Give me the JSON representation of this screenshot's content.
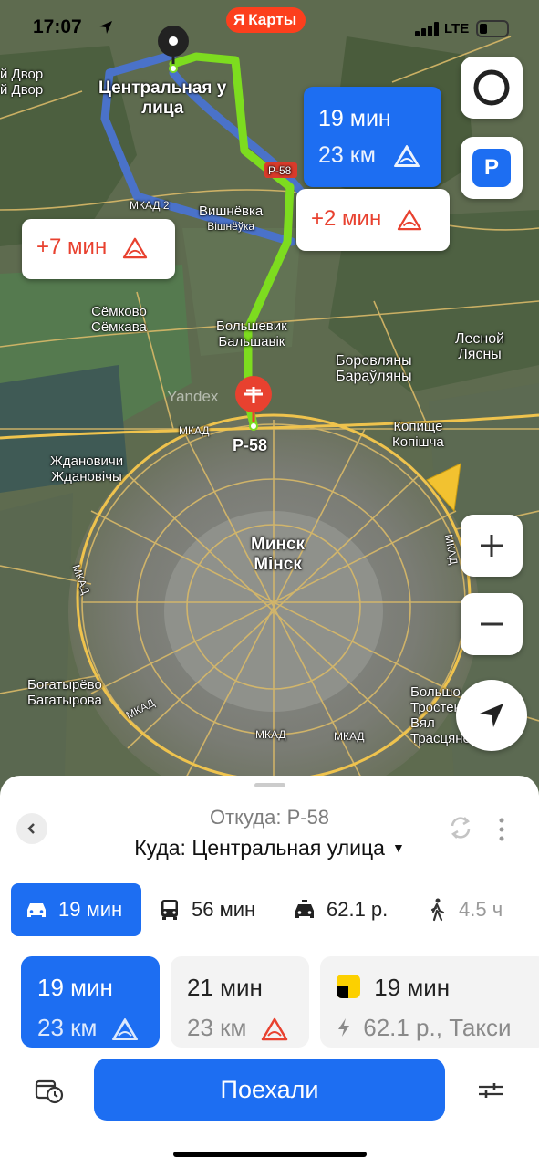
{
  "status_bar": {
    "time": "17:07",
    "network": "LTE"
  },
  "app_badge": {
    "logo": "Я",
    "label": "Карты"
  },
  "map": {
    "watermark": "Yandex",
    "labels": {
      "dvor1": "й Двор",
      "dvor2": "й Двор",
      "central1": "Центральная у",
      "central2": "лица",
      "vishnevka1": "Вишнёвка",
      "vishnevka2": "Вішнёўка",
      "mkad2": "МКАД 2",
      "p58_top": "Р-58",
      "semkovo1": "Сёмково",
      "semkovo2": "Сёмкава",
      "bolshevik1": "Большевик",
      "bolshevik2": "Бальшавік",
      "lesnoy1": "Лесной",
      "lesnoy2": "Лясны",
      "borovlyany1": "Боровляны",
      "borovlyany2": "Бараўляны",
      "mkad_center": "МКАД",
      "p58_bottom": "Р-58",
      "kopishche1": "Копище",
      "kopishche2": "Копішча",
      "zhdanovichi1": "Ждановичи",
      "zhdanovichi2": "Ждановічы",
      "minsk1": "Минск",
      "minsk2": "Мінск",
      "mkad_left": "МКАД",
      "mkad_right": "МКАД",
      "bogatyrevo1": "Богатырёво",
      "bogatyrevo2": "Багатырова",
      "mkad_bl": "МКАД",
      "mkad_b1": "МКАД",
      "mkad_b2": "МКАД",
      "bolshoe1": "Большо",
      "trostenets1": "Тростенец",
      "trostenets2": "Вял",
      "trostenets3": "Трасцянец"
    },
    "callouts": {
      "main_time": "19 мин",
      "main_dist": "23 км",
      "alt1": "+7 мин",
      "alt2": "+2 мин"
    },
    "parking_label": "P"
  },
  "sheet": {
    "from": "Откуда: Р-58",
    "to": "Куда: Центральная улица",
    "modes": [
      {
        "label": "19 мин",
        "icon": "car-icon"
      },
      {
        "label": "56 мин",
        "icon": "bus-icon"
      },
      {
        "label": "62.1 р.",
        "icon": "taxi-icon"
      },
      {
        "label": "4.5 ч",
        "icon": "walk-icon"
      }
    ],
    "routes": [
      {
        "time": "19 мин",
        "detail": "23 км"
      },
      {
        "time": "21 мин",
        "detail": "23 км"
      },
      {
        "time": "19 мин",
        "detail": "62.1 р., Такси"
      }
    ],
    "go_button": "Поехали"
  },
  "colors": {
    "accent": "#1d6ef2",
    "route_green": "#7ddc1f",
    "route_alt": "#4a72c9",
    "warning": "#e8412f",
    "ya_red": "#fc3f1d"
  }
}
